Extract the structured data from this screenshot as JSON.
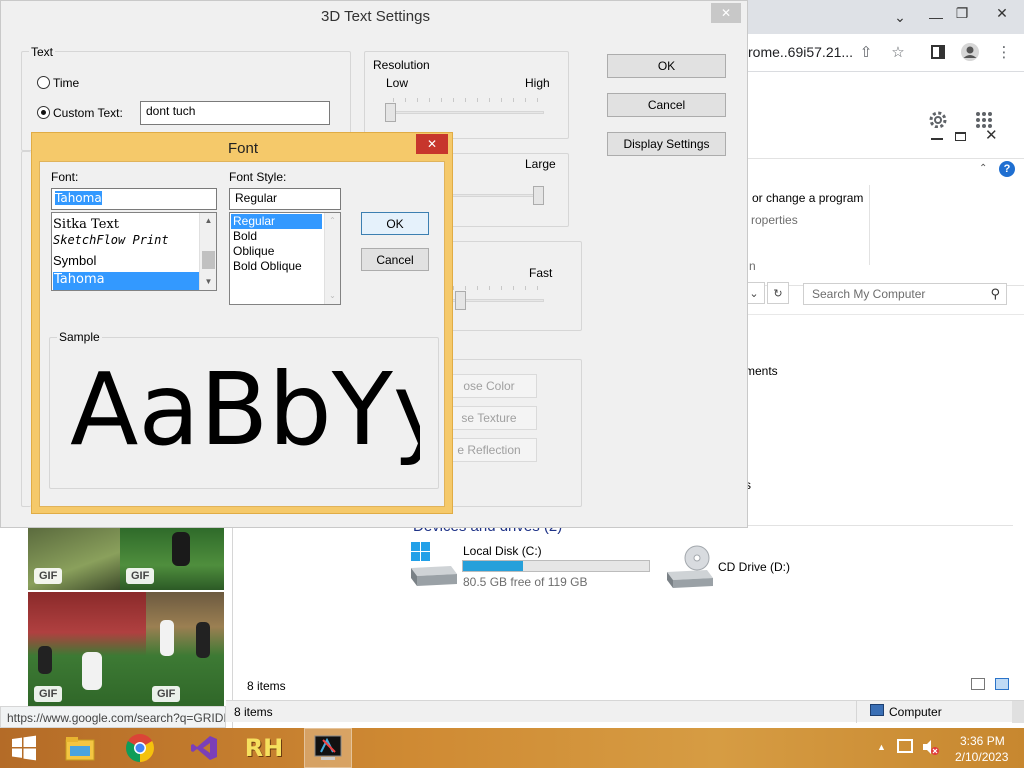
{
  "chrome": {
    "address_fragment": "rome..69i57.21...",
    "status_url": "https://www.google.com/search?q=GRIDI",
    "gif_badge": "GIF"
  },
  "explorer": {
    "ribbon_text_1": "or change a program",
    "ribbon_text_2": "roperties",
    "ribbon_text_3": "n",
    "search_placeholder": "Search My Computer",
    "section_text_documents": "ments",
    "section_text_s": "s",
    "devices_header": "Devices and drives (2)",
    "drives": [
      {
        "name": "Local Disk (C:)",
        "free_text": "80.5 GB free of 119 GB",
        "used_fraction": 0.32
      },
      {
        "name": "CD Drive (D:)"
      }
    ],
    "items_count_inner": "8 items",
    "items_count_status": "8 items",
    "computer_label": "Computer"
  },
  "settings3d": {
    "title": "3D Text Settings",
    "text_group": "Text",
    "time_option": "Time",
    "custom_text_option": "Custom Text:",
    "custom_text_value": "dont tuch",
    "resolution_group": "Resolution",
    "res_low": "Low",
    "res_high": "High",
    "size_large": "Large",
    "speed_fast": "Fast",
    "ok_label": "OK",
    "cancel_label": "Cancel",
    "display_settings_label": "Display Settings",
    "choose_color": "ose Color",
    "choose_texture": "se Texture",
    "choose_reflection": "e Reflection",
    "group_fragment_1": "I",
    "group_fragment_2": "S"
  },
  "font_dialog": {
    "title": "Font",
    "font_label": "Font:",
    "font_value": "Tahoma",
    "font_list": [
      "Sitka Text",
      "SketchFlow Print",
      "Symbol",
      "Tahoma"
    ],
    "selected_font": "Tahoma",
    "style_label": "Font Style:",
    "style_value": "Regular",
    "style_list": [
      "Regular",
      "Bold",
      "Oblique",
      "Bold Oblique"
    ],
    "selected_style": "Regular",
    "ok_label": "OK",
    "cancel_label": "Cancel",
    "sample_label": "Sample",
    "sample_text": "AaBbYyZz"
  },
  "taskbar": {
    "time": "3:36 PM",
    "date": "2/10/2023",
    "apps": [
      "windows-start-icon",
      "file-explorer-icon",
      "chrome-icon",
      "visual-studio-icon",
      "rh-app-icon",
      "3d-text-app-icon"
    ]
  },
  "colors": {
    "dialog_accent": "#f5c96a",
    "selection": "#3399ff",
    "close_red": "#c7362c",
    "progress": "#26a0da",
    "taskbar": "#c9832f"
  }
}
